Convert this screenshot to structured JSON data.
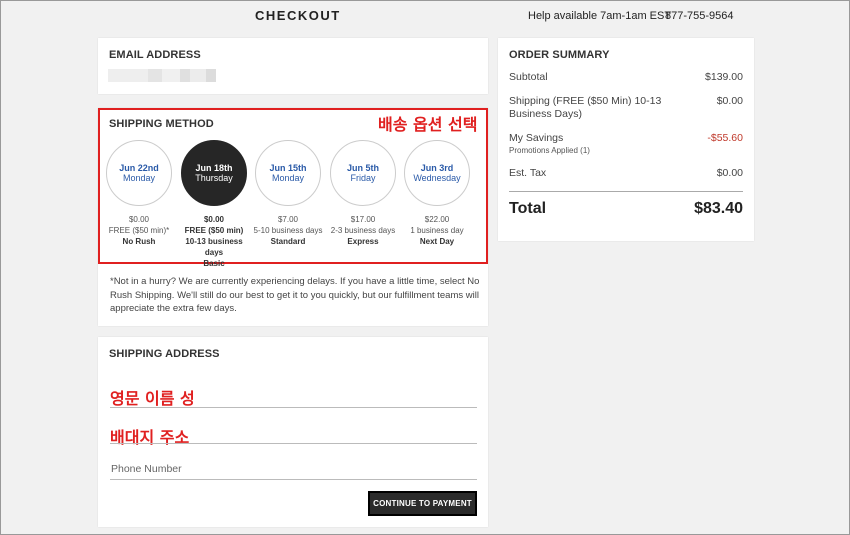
{
  "header": {
    "title": "CHECKOUT",
    "help": "Help available 7am-1am EST",
    "phone": "877-755-9564"
  },
  "email": {
    "title": "EMAIL ADDRESS"
  },
  "shipping": {
    "title": "SHIPPING METHOD",
    "annotation": "배송 옵션 선택",
    "options": [
      {
        "date": "Jun 22nd",
        "day": "Monday",
        "price": "$0.00",
        "desc": "FREE ($50 min)*",
        "name": "No Rush"
      },
      {
        "date": "Jun 18th",
        "day": "Thursday",
        "price": "$0.00",
        "desc": "FREE ($50 min) 10-13 business days",
        "name": "Basic"
      },
      {
        "date": "Jun 15th",
        "day": "Monday",
        "price": "$7.00",
        "desc": "5-10 business days",
        "name": "Standard"
      },
      {
        "date": "Jun 5th",
        "day": "Friday",
        "price": "$17.00",
        "desc": "2-3 business days",
        "name": "Express"
      },
      {
        "date": "Jun 3rd",
        "day": "Wednesday",
        "price": "$22.00",
        "desc": "1 business day",
        "name": "Next Day"
      }
    ],
    "selected_index": 1,
    "note": "*Not in a hurry? We are currently experiencing delays. If you have a little time, select No Rush Shipping. We'll still do our best to get it to you quickly, but our fulfillment teams will appreciate the extra few days."
  },
  "address": {
    "title": "SHIPPING ADDRESS",
    "annotation_name": "영문 이름 성",
    "annotation_addr": "배대지 주소",
    "phone_placeholder": "Phone Number",
    "continue_label": "CONTINUE TO PAYMENT"
  },
  "summary": {
    "title": "ORDER SUMMARY",
    "subtotal_label": "Subtotal",
    "subtotal": "$139.00",
    "shipping_label": "Shipping (FREE ($50 Min) 10-13 Business Days)",
    "shipping": "$0.00",
    "savings_label": "My Savings",
    "savings_sub": "Promotions Applied (1)",
    "savings": "-$55.60",
    "tax_label": "Est. Tax",
    "tax": "$0.00",
    "total_label": "Total",
    "total": "$83.40"
  },
  "colors": {
    "annotation": "#e02020",
    "selected": "#262626",
    "date_blue": "#2a5aa8",
    "savings_red": "#c0392b"
  }
}
